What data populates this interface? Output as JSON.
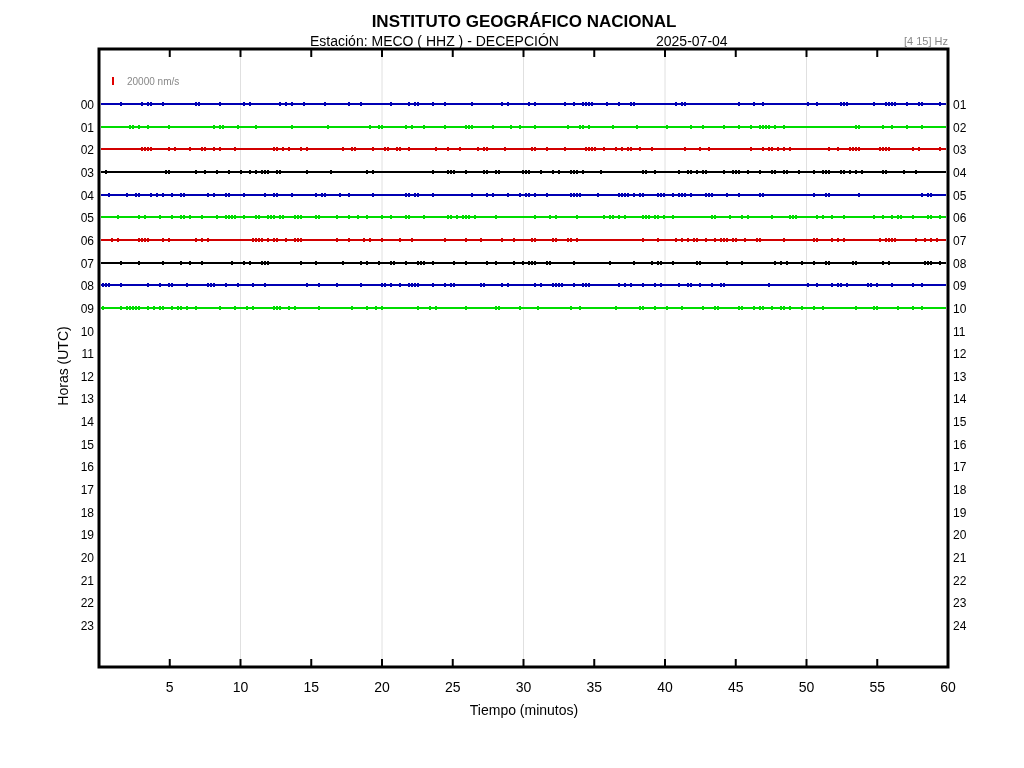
{
  "title": "INSTITUTO GEOGRÁFICO NACIONAL",
  "subtitle": "Estación:  MECO ( HHZ ) - DECEPCIÓN",
  "date": "2025-07-04",
  "filter": "[4 15] Hz",
  "scale_label": "20000 nm/s",
  "ylabel": "Horas (UTC)",
  "xlabel": "Tiempo (minutos)",
  "left_labels": [
    "00",
    "01",
    "02",
    "03",
    "04",
    "05",
    "06",
    "07",
    "08",
    "09",
    "10",
    "11",
    "12",
    "13",
    "14",
    "15",
    "16",
    "17",
    "18",
    "19",
    "20",
    "21",
    "22",
    "23"
  ],
  "right_labels": [
    "01",
    "02",
    "03",
    "04",
    "05",
    "06",
    "07",
    "08",
    "09",
    "10",
    "11",
    "12",
    "13",
    "14",
    "15",
    "16",
    "17",
    "18",
    "19",
    "20",
    "21",
    "22",
    "23",
    "24"
  ],
  "x_ticks": [
    "5",
    "10",
    "15",
    "20",
    "25",
    "30",
    "35",
    "40",
    "45",
    "50",
    "55",
    "60"
  ],
  "traces": [
    {
      "color": "#0000b4"
    },
    {
      "color": "#00dc00"
    },
    {
      "color": "#d20000"
    },
    {
      "color": "#000000"
    },
    {
      "color": "#0000b4"
    },
    {
      "color": "#00dc00"
    },
    {
      "color": "#d20000"
    },
    {
      "color": "#000000"
    },
    {
      "color": "#0000b4"
    },
    {
      "color": "#00dc00"
    }
  ]
}
